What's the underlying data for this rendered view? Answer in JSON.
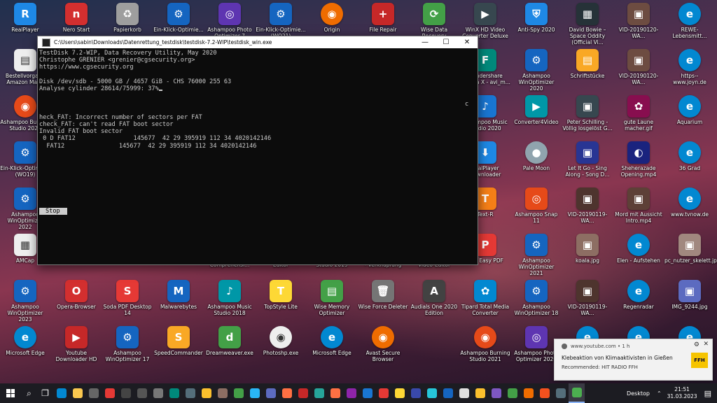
{
  "desktop_icons": [
    {
      "label": "RealPlayer",
      "color": "#1e88e5",
      "glyph": "R"
    },
    {
      "label": "Nero Start",
      "color": "#d32f2f",
      "glyph": "n"
    },
    {
      "label": "Papierkorb",
      "color": "#9e9e9e",
      "glyph": "♻"
    },
    {
      "label": "Ein-Klick-Optimie...",
      "color": "#1565c0",
      "glyph": "⚙"
    },
    {
      "label": "Ashampoo Photo Optimizer 7",
      "color": "#5e35b1",
      "glyph": "◎"
    },
    {
      "label": "Ein-Klick-Optimie... (WO21)",
      "color": "#1565c0",
      "glyph": "⚙"
    },
    {
      "label": "Origin",
      "color": "#ef6c00",
      "glyph": "◉"
    },
    {
      "label": "File Repair",
      "color": "#c62828",
      "glyph": "+"
    },
    {
      "label": "Wise Data Recovery",
      "color": "#43a047",
      "glyph": "⟳"
    },
    {
      "label": "WinX HD Video Converter Deluxe",
      "color": "#37474f",
      "glyph": "▶"
    },
    {
      "label": "Anti-Spy 2020",
      "color": "#1e88e5",
      "glyph": "⛨"
    },
    {
      "label": "David Bowie – Space Oddity (Official Vi...",
      "color": "#263238",
      "glyph": "▦"
    },
    {
      "label": "VID-20190120-WA...",
      "color": "#6d4c41",
      "glyph": "▣"
    },
    {
      "label": "REWE-Lebensmitt...",
      "color": "#0288d1",
      "glyph": "e"
    },
    {
      "label": "Bestellvorgang Amazon Mar...",
      "color": "#eeeeee",
      "glyph": "▤"
    },
    {
      "label": "Wondershare Filmora X - avi_m...",
      "color": "#00897b",
      "glyph": "F"
    },
    {
      "label": "Ashampoo WinOptimizer 2020",
      "color": "#1565c0",
      "glyph": "⚙"
    },
    {
      "label": "Schriftstücke",
      "color": "#f9a825",
      "glyph": "▤"
    },
    {
      "label": "VID-20190120-WA...",
      "color": "#6d4c41",
      "glyph": "▣"
    },
    {
      "label": "https--www.joyn.de",
      "color": "#0288d1",
      "glyph": "e"
    },
    {
      "label": "Ashampoo Burning Studio 2022",
      "color": "#e64a19",
      "glyph": "◉"
    },
    {
      "label": "Ashampoo Music Studio 2020",
      "color": "#1976d2",
      "glyph": "♪"
    },
    {
      "label": "Converter4Video",
      "color": "#0097a7",
      "glyph": "▶"
    },
    {
      "label": "Peter Schilling - Völlig losgelöst G...",
      "color": "#37474f",
      "glyph": "▣"
    },
    {
      "label": "gute Laune macher.gif",
      "color": "#880e4f",
      "glyph": "✿"
    },
    {
      "label": "Aquarium",
      "color": "#0288d1",
      "glyph": "e"
    },
    {
      "label": "Ein-Klick-Optimie... (WO19)",
      "color": "#1565c0",
      "glyph": "⚙"
    },
    {
      "label": "RealPlayer Downloader",
      "color": "#1e88e5",
      "glyph": "⬇"
    },
    {
      "label": "Pale Moon",
      "color": "#90a4ae",
      "glyph": "●"
    },
    {
      "label": "Let It Go - Sing Along - Song D...",
      "color": "#283593",
      "glyph": "▣"
    },
    {
      "label": "Sheherazade Opening.mp4",
      "color": "#1a237e",
      "glyph": "◐"
    },
    {
      "label": "36 Grad",
      "color": "#0288d1",
      "glyph": "e"
    },
    {
      "label": "Ashampoo WinOptimizer 2022",
      "color": "#1565c0",
      "glyph": "⚙"
    },
    {
      "label": "Text-R",
      "color": "#f57f17",
      "glyph": "T"
    },
    {
      "label": "Ashampoo Snap 11",
      "color": "#e64a19",
      "glyph": "◎"
    },
    {
      "label": "VID-20190119-WA...",
      "color": "#4e342e",
      "glyph": "▣"
    },
    {
      "label": "Mord mit Aussicht Intro.mp4",
      "color": "#5d4037",
      "glyph": "▣"
    },
    {
      "label": "www.tvnow.de",
      "color": "#0288d1",
      "glyph": "e"
    },
    {
      "label": "AMCap",
      "color": "#eeeeee",
      "glyph": "▦"
    },
    {
      "label": "Soft Easy PDF",
      "color": "#e53935",
      "glyph": "P"
    },
    {
      "label": "Ashampoo WinOptimizer 2021",
      "color": "#1565c0",
      "glyph": "⚙"
    },
    {
      "label": "koala.jpg",
      "color": "#8d6e63",
      "glyph": "▣"
    },
    {
      "label": "Elen - Aufstehen",
      "color": "#0288d1",
      "glyph": "e"
    },
    {
      "label": "pc_nutzer_skelett.jpg",
      "color": "#a1887f",
      "glyph": "▣"
    },
    {
      "label": "Comprehensi...",
      "color": "",
      "glyph": ""
    },
    {
      "label": "Editor",
      "color": "",
      "glyph": ""
    },
    {
      "label": "Studio 2019",
      "color": "",
      "glyph": ""
    },
    {
      "label": "- Verknüpfung",
      "color": "",
      "glyph": ""
    },
    {
      "label": "Video-Editor",
      "color": "",
      "glyph": ""
    },
    {
      "label": "Ashampoo WinOptimizer 2023",
      "color": "#1565c0",
      "glyph": "⚙"
    },
    {
      "label": "Opera-Browser",
      "color": "#d32f2f",
      "glyph": "O"
    },
    {
      "label": "Soda PDF Desktop 14",
      "color": "#e53935",
      "glyph": "S"
    },
    {
      "label": "Malwarebytes",
      "color": "#1565c0",
      "glyph": "M"
    },
    {
      "label": "Ashampoo Music Studio 2018",
      "color": "#0097a7",
      "glyph": "♪"
    },
    {
      "label": "TopStyle Lite",
      "color": "#fdd835",
      "glyph": "T"
    },
    {
      "label": "Wise Memory Optimizer",
      "color": "#43a047",
      "glyph": "▤"
    },
    {
      "label": "Wise Force Deleter",
      "color": "#757575",
      "glyph": "🗑"
    },
    {
      "label": "Audials One 2020 Edition",
      "color": "#424242",
      "glyph": "A"
    },
    {
      "label": "Tipard Total Media Converter",
      "color": "#0288d1",
      "glyph": "✿"
    },
    {
      "label": "Ashampoo WinOptimizer 18",
      "color": "#1565c0",
      "glyph": "⚙"
    },
    {
      "label": "VID-20190119-WA...",
      "color": "#4e342e",
      "glyph": "▣"
    },
    {
      "label": "Regenradar",
      "color": "#0288d1",
      "glyph": "e"
    },
    {
      "label": "IMG_9244.jpg",
      "color": "#5c6bc0",
      "glyph": "▣"
    },
    {
      "label": "Microsoft Edge",
      "color": "#0288d1",
      "glyph": "e"
    },
    {
      "label": "Youtube Downloader HD",
      "color": "#c62828",
      "glyph": "▶"
    },
    {
      "label": "Ashampoo WinOptimizer 17",
      "color": "#1565c0",
      "glyph": "⚙"
    },
    {
      "label": "SpeedCommander",
      "color": "#f9a825",
      "glyph": "S"
    },
    {
      "label": "Dreamweaver.exe",
      "color": "#43a047",
      "glyph": "d"
    },
    {
      "label": "Photoshp.exe",
      "color": "#eeeeee",
      "glyph": "◉"
    },
    {
      "label": "Microsoft Edge",
      "color": "#0288d1",
      "glyph": "e"
    },
    {
      "label": "Avast Secure Browser",
      "color": "#ef6c00",
      "glyph": "◉"
    },
    {
      "label": "Ashampoo Burning Studio 2021",
      "color": "#e64a19",
      "glyph": "◉"
    },
    {
      "label": "Ashampoo Photo Optimizer 2020",
      "color": "#5e35b1",
      "glyph": "◎"
    },
    {
      "label": "",
      "color": "#0288d1",
      "glyph": "e"
    },
    {
      "label": "",
      "color": "#0288d1",
      "glyph": "e"
    },
    {
      "label": "",
      "color": "#0288d1",
      "glyph": "e"
    }
  ],
  "console_window": {
    "title": "C:\\Users\\sabin\\Downloads\\Datenrettung_testdisk\\testdisk-7.2-WIP\\testdisk_win.exe",
    "minimize": "—",
    "maximize": "☐",
    "close": "✕",
    "lines": [
      "TestDisk 7.2-WIP, Data Recovery Utility, May 2020",
      "Christophe GRENIER <grenier@cgsecurity.org>",
      "https://www.cgsecurity.org",
      "",
      "Disk /dev/sdb - 5000 GB / 4657 GiB - CHS 76000 255 63",
      "Analyse cylinder 28614/75999: 37%",
      "",
      "",
      "",
      "heck_FAT: Incorrect number of sectors per FAT",
      "check_FAT: can't read FAT boot sector",
      "Invalid FAT boot sector",
      " 0 D FAT12                145677  42 29 395919 112 34 4020142146",
      "  FAT12               145677  42 29 395919 112 34 4020142146"
    ],
    "side_char": "c",
    "stop_label": "Stop"
  },
  "notification": {
    "source": "www.youtube.com",
    "age": "• 1 h",
    "title": "Klebeaktion von Klimaaktivisten in Gießen",
    "subtitle": "Recommended: HIT RADIO FFH",
    "badge": "FFH",
    "gear": "⚙",
    "close": "✕"
  },
  "taskbar": {
    "apps": [
      {
        "name": "search-icon",
        "color": "#1c1c22",
        "glyph": "⌕"
      },
      {
        "name": "task-view-icon",
        "color": "#1c1c22",
        "glyph": "❐"
      },
      {
        "name": "edge-icon",
        "color": "#0288d1"
      },
      {
        "name": "explorer-icon",
        "color": "#f9c74f"
      },
      {
        "name": "app-6-icon",
        "color": "#666"
      },
      {
        "name": "chrome-icon",
        "color": "#e53935"
      },
      {
        "name": "settings-icon",
        "color": "#444"
      },
      {
        "name": "app-8-icon",
        "color": "#555"
      },
      {
        "name": "app-9-icon",
        "color": "#777"
      },
      {
        "name": "app-10-icon",
        "color": "#00897b"
      },
      {
        "name": "app-11-icon",
        "color": "#546e7a"
      },
      {
        "name": "app-12-icon",
        "color": "#fbc02d"
      },
      {
        "name": "app-13-icon",
        "color": "#8d6e63"
      },
      {
        "name": "app-14-icon",
        "color": "#43a047"
      },
      {
        "name": "app-15-icon",
        "color": "#29b6f6"
      },
      {
        "name": "app-16-icon",
        "color": "#5c6bc0"
      },
      {
        "name": "app-17-icon",
        "color": "#ff7043"
      },
      {
        "name": "app-18-icon",
        "color": "#c62828"
      },
      {
        "name": "app-19-icon",
        "color": "#26a69a"
      },
      {
        "name": "firefox-icon",
        "color": "#ff7043"
      },
      {
        "name": "app-21-icon",
        "color": "#8e24aa"
      },
      {
        "name": "app-22-icon",
        "color": "#1976d2"
      },
      {
        "name": "app-23-icon",
        "color": "#e53935"
      },
      {
        "name": "app-24-icon",
        "color": "#fdd835"
      },
      {
        "name": "app-25-icon",
        "color": "#3949ab"
      },
      {
        "name": "app-26-icon",
        "color": "#26c6da"
      },
      {
        "name": "app-27-icon",
        "color": "#1565c0"
      },
      {
        "name": "app-28-icon",
        "color": "#e0e0e0"
      },
      {
        "name": "app-29-icon",
        "color": "#fbc02d"
      },
      {
        "name": "app-30-icon",
        "color": "#7e57c2"
      },
      {
        "name": "app-31-icon",
        "color": "#43a047"
      },
      {
        "name": "app-32-icon",
        "color": "#ef6c00"
      },
      {
        "name": "app-33-icon",
        "color": "#f4511e"
      },
      {
        "name": "app-34-icon",
        "color": "#546e7a"
      },
      {
        "name": "testdisk-taskbar-icon",
        "color": "#4caf50",
        "active": true
      }
    ],
    "desktop_label": "Desktop",
    "chevron": "⌃",
    "time": "21:51",
    "date": "31.03.2023",
    "notification_glyph": "▤"
  }
}
